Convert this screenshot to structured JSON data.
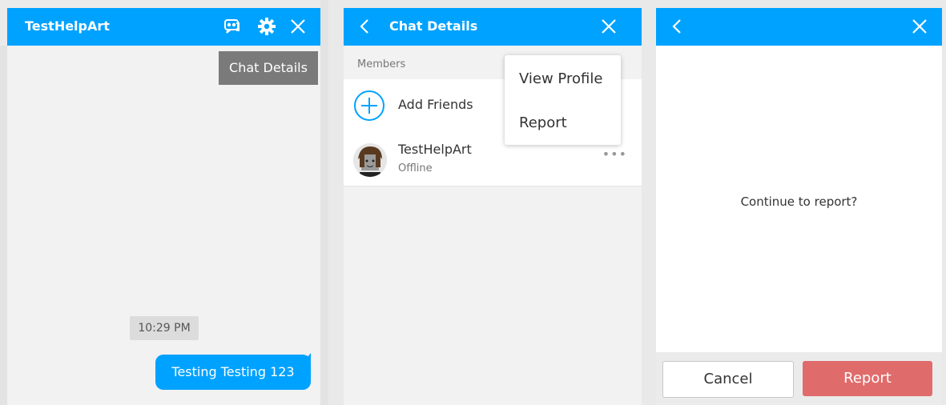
{
  "chat_window": {
    "title": "TestHelpArt",
    "tooltip": "Chat Details",
    "timestamp": "10:29 PM",
    "message": "Testing Testing 123"
  },
  "details_panel": {
    "title": "Chat Details",
    "members_label": "Members",
    "add_friends_label": "Add Friends",
    "member": {
      "name": "TestHelpArt",
      "status": "Offline"
    },
    "more_label": "•••",
    "menu": {
      "view_profile": "View Profile",
      "report": "Report"
    }
  },
  "report_dialog": {
    "prompt": "Continue to report?",
    "cancel_label": "Cancel",
    "report_label": "Report"
  },
  "colors": {
    "header_blue": "#00a2ff",
    "report_red": "#e06b6b"
  }
}
